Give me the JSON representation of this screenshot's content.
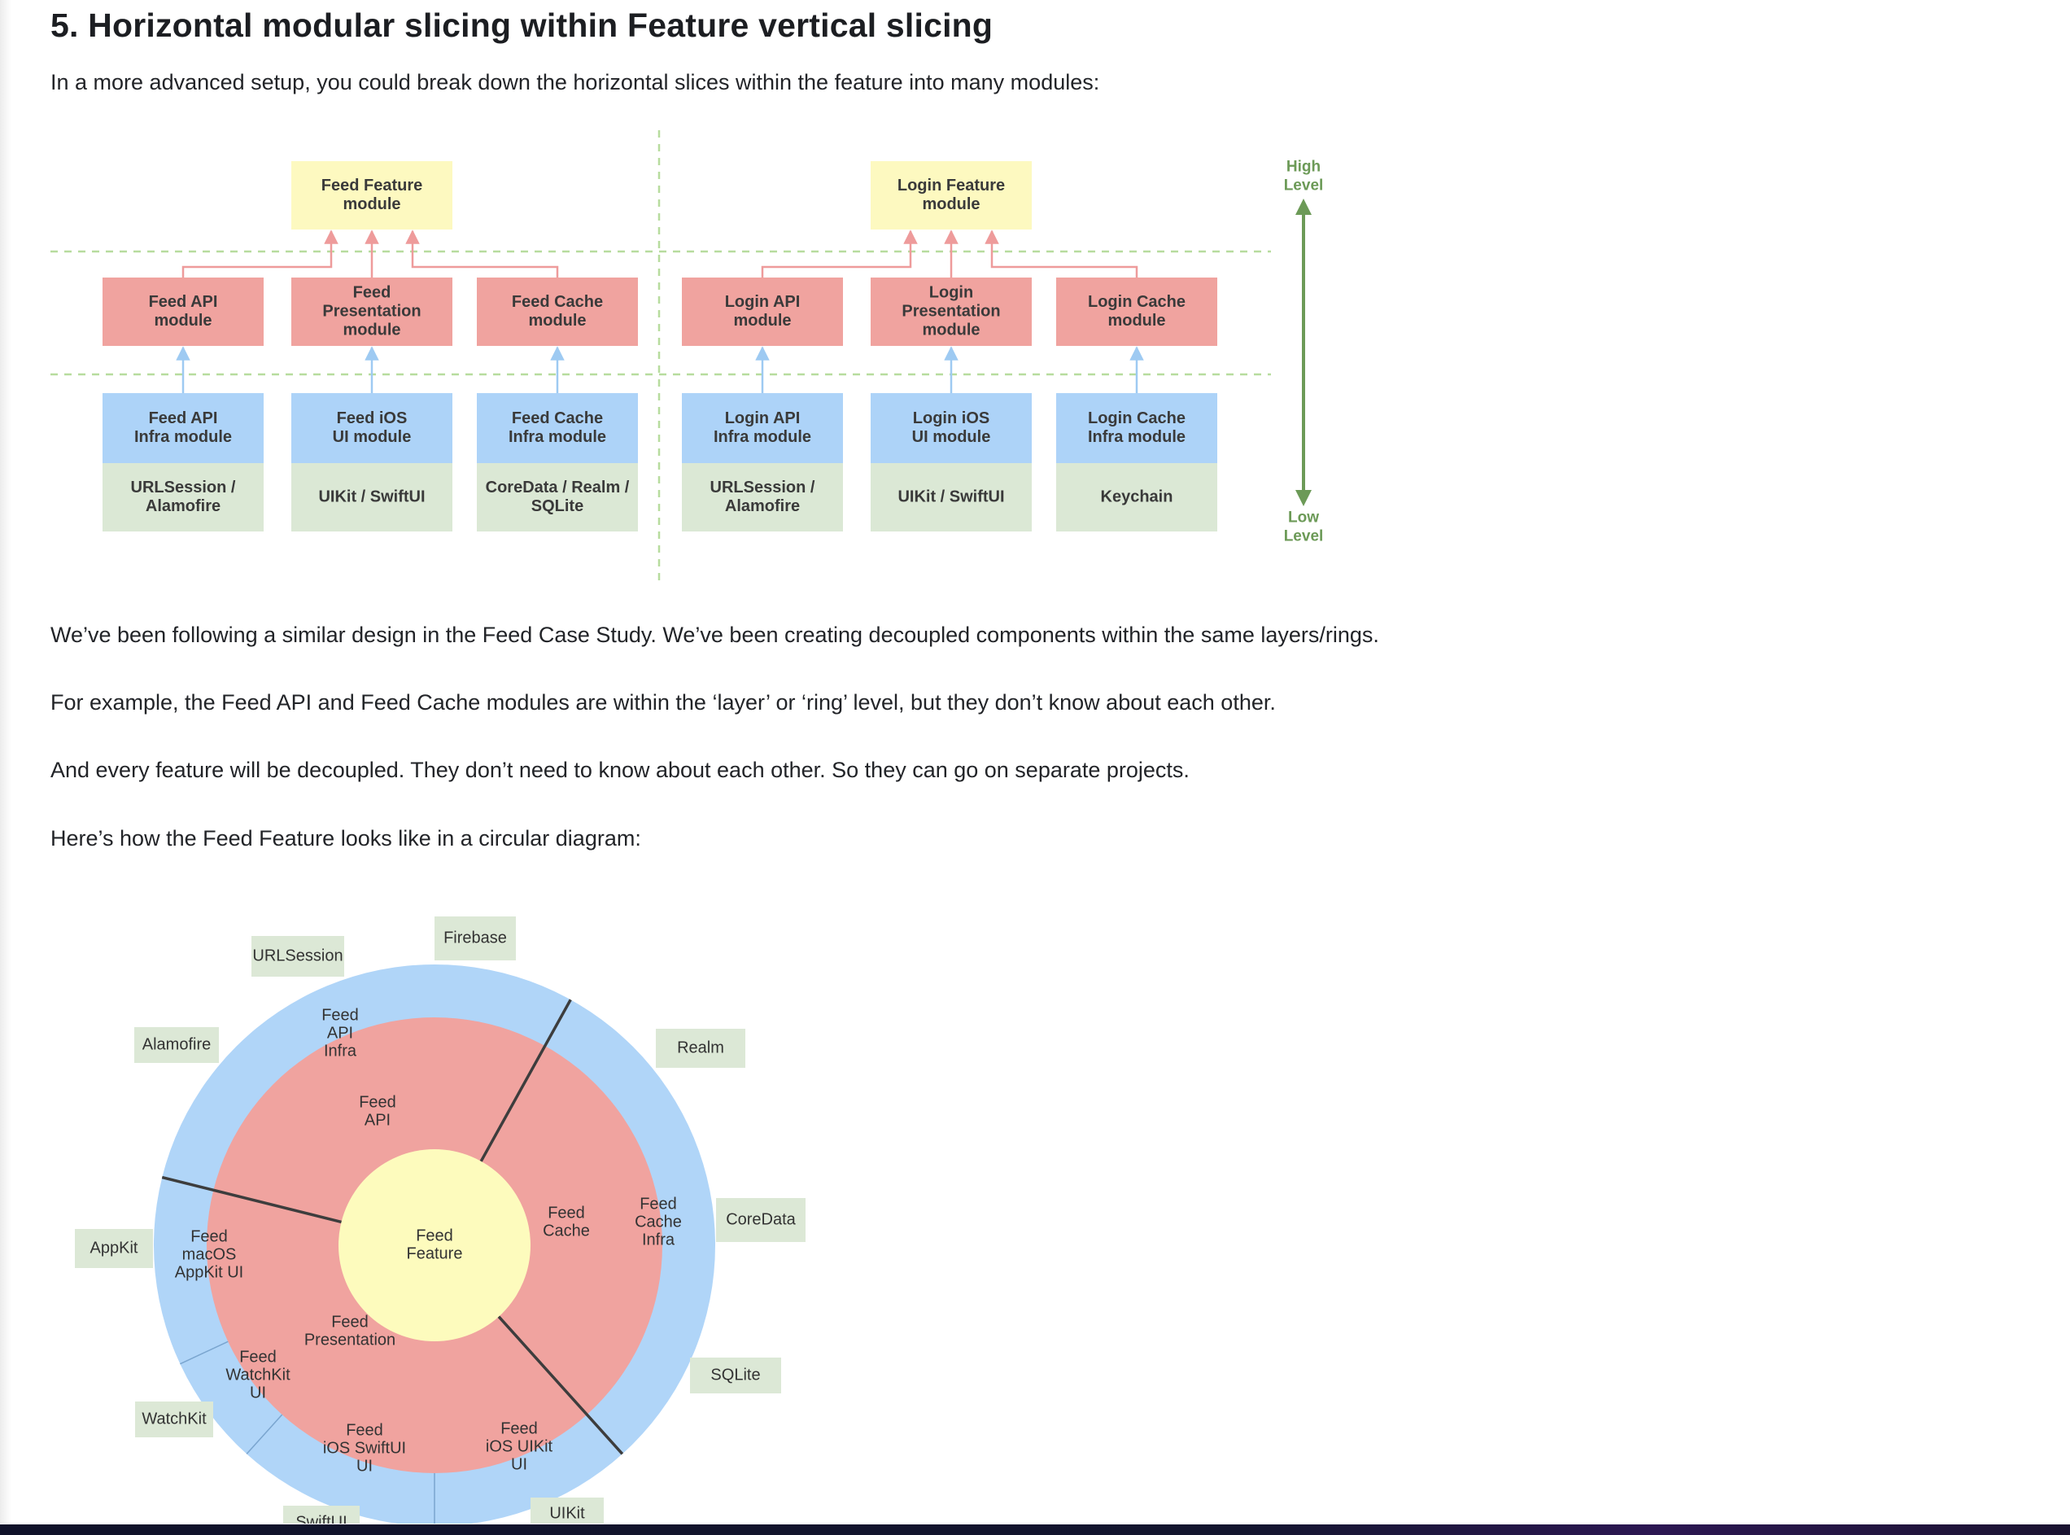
{
  "page": {
    "heading": "5. Horizontal modular slicing within Feature vertical slicing",
    "intro": "In a more advanced setup, you could break down the horizontal slices within the feature into many modules:",
    "paragraphs": [
      "We’ve been following a similar design in the Feed Case Study. We’ve been creating decoupled components within the same layers/rings.",
      "For example, the Feed API and Feed Cache modules are within the ‘layer’ or ‘ring’ level, but they don’t know about each other.",
      "And every feature will be decoupled. They don’t need to know about each other. So they can go on separate projects.",
      "Here’s how the Feed Feature looks like in a circular diagram:"
    ]
  },
  "layer_diagram": {
    "colors": {
      "feature": "#fdf9c0",
      "module": "#f0a39f",
      "infra": "#add3f8",
      "framework": "#dbe8d5",
      "dashed": "#b7dc9e",
      "level_arrow": "#6c9a57",
      "red_arrow": "#ee9b9b",
      "blue_arrow": "#9ecaf2"
    },
    "features": [
      {
        "name": "Feed Feature\nmodule",
        "modules": [
          "Feed API\nmodule",
          "Feed\nPresentation\nmodule",
          "Feed Cache\nmodule"
        ],
        "infra": [
          "Feed API\nInfra module",
          "Feed iOS\nUI module",
          "Feed Cache\nInfra module"
        ],
        "frameworks": [
          "URLSession /\nAlamofire",
          "UIKit / SwiftUI",
          "CoreData / Realm /\nSQLite"
        ]
      },
      {
        "name": "Login Feature\nmodule",
        "modules": [
          "Login API\nmodule",
          "Login\nPresentation\nmodule",
          "Login Cache\nmodule"
        ],
        "infra": [
          "Login API\nInfra module",
          "Login iOS\nUI module",
          "Login Cache\nInfra module"
        ],
        "frameworks": [
          "URLSession /\nAlamofire",
          "UIKit / SwiftUI",
          "Keychain"
        ]
      }
    ],
    "high_level": "High\nLevel",
    "low_level": "Low\nLevel"
  },
  "circle_diagram": {
    "colors": {
      "core": "#fdfbbd",
      "ring": "#f0a39f",
      "outer": "#b0d5f8",
      "tag": "#dce8d6",
      "divider": "#3d3d3d",
      "thin_divider": "#7aa5cf"
    },
    "core": "Feed\nFeature",
    "inner_ring": [
      "Feed\nAPI",
      "Feed\nCache",
      "Feed\nPresentation"
    ],
    "outer_ring": [
      "Feed\nAPI\nInfra",
      "Feed\nCache\nInfra",
      "Feed\niOS UIKit\nUI",
      "Feed\niOS SwiftUI\nUI",
      "Feed\nWatchKit\nUI",
      "Feed\nmacOS\nAppKit UI"
    ],
    "tags": [
      "URLSession",
      "Firebase",
      "Alamofire",
      "Realm",
      "CoreData",
      "AppKit",
      "SQLite",
      "WatchKit",
      "UIKit",
      "SwiftUI"
    ]
  }
}
